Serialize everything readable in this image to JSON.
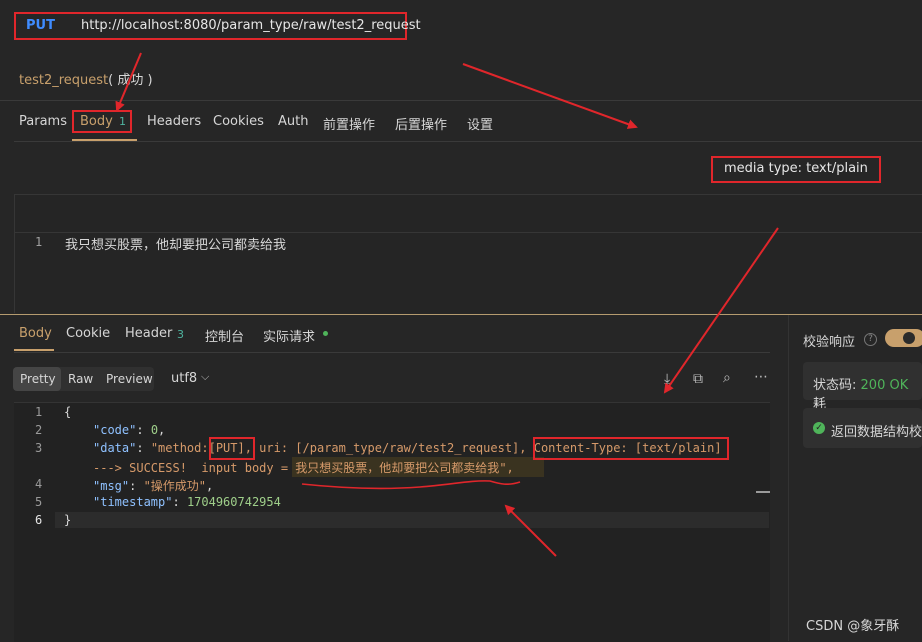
{
  "request": {
    "method": "PUT",
    "url": "http://localhost:8080/param_type/raw/test2_request",
    "name": "test2_request",
    "status_text": "( 成功 )"
  },
  "request_tabs": {
    "params": "Params",
    "body": "Body",
    "body_count": "1",
    "headers": "Headers",
    "cookies": "Cookies",
    "auth": "Auth",
    "pre_ops": "前置操作",
    "post_ops": "后置操作",
    "settings": "设置"
  },
  "media_type": "media type: text/plain",
  "editor": {
    "line_number": "1",
    "text": "我只想买股票，他却要把公司都卖给我"
  },
  "response_tabs": {
    "body": "Body",
    "cookie": "Cookie",
    "header": "Header",
    "header_count": "3",
    "console": "控制台",
    "actual_request": "实际请求"
  },
  "view_modes": {
    "pretty": "Pretty",
    "raw": "Raw",
    "preview": "Preview",
    "encoding": "utf8"
  },
  "response_code": {
    "line_numbers": [
      "1",
      "2",
      "3",
      "4",
      "5",
      "6"
    ],
    "l1": "{",
    "code_key": "\"code\"",
    "code_val": "0",
    "data_key": "\"data\"",
    "data_part1": "\"method:",
    "data_put": "[PUT]",
    "data_part2": ", uri: [/param_type/raw/test2_request],",
    "data_ct": "Content-Type: [text/plain]",
    "data_part3": "---> SUCCESS!  input body = ",
    "data_cn": "我只想买股票，他却要把公司都卖给我",
    "data_end": "\",",
    "msg_key": "\"msg\"",
    "msg_val": "\"操作成功\"",
    "ts_key": "\"timestamp\"",
    "ts_val": "1704960742954",
    "l6": "}"
  },
  "side_panel": {
    "verify_label": "校验响应",
    "status_label": "状态码:",
    "status_value": "200 OK",
    "status_extra": "耗",
    "schema_text": "返回数据结构校"
  },
  "watermark": "CSDN @象牙酥",
  "colors": {
    "accent": "#c8a06c",
    "method": "#3f8cff",
    "annotation": "#e0262b",
    "success": "#4fb45a"
  }
}
